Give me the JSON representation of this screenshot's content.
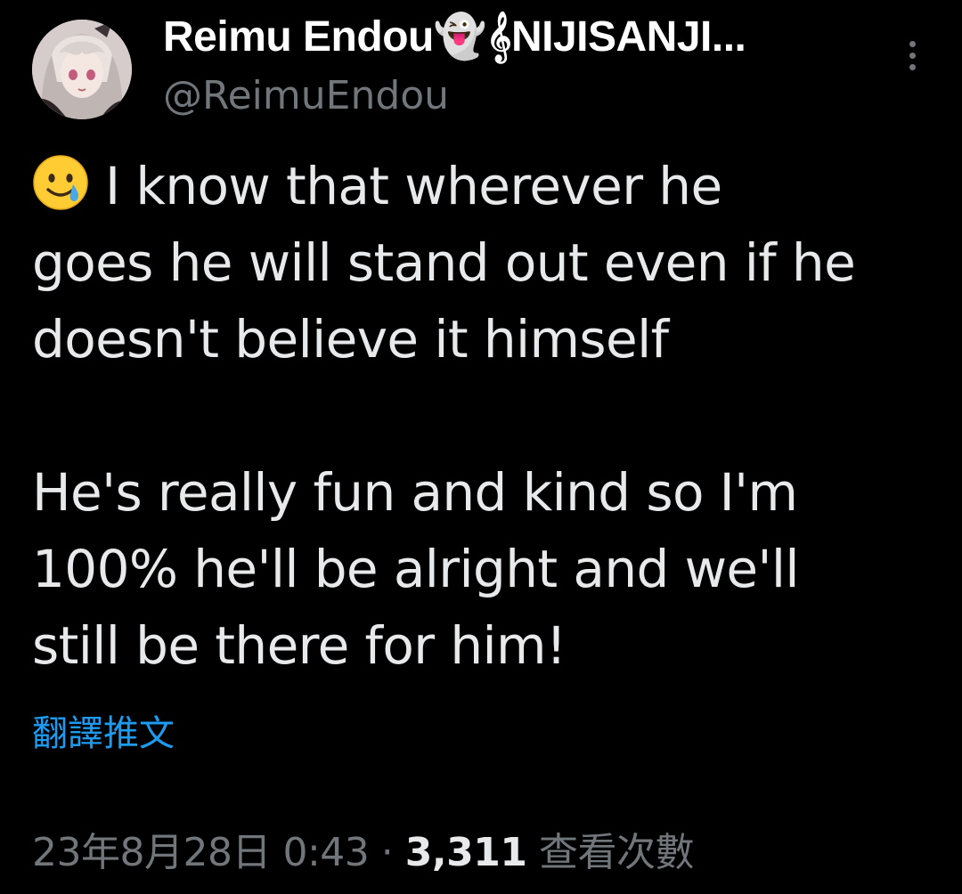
{
  "author": {
    "display_name": "Reimu Endou👻𝄞NIJISANJI...",
    "handle": "@ReimuEndou",
    "avatar_icon": "anime-avatar"
  },
  "tweet": {
    "emoji": "smiling-face-with-tear",
    "lines": [
      "I know that wherever he",
      "goes he will stand out even if he",
      "doesn't believe it himself",
      "",
      "He's really fun and kind so I'm",
      "100% he'll be alright and we'll",
      "still be there for him!"
    ],
    "translate_label": "翻譯推文"
  },
  "meta": {
    "timestamp": "23年8月28日 0:43",
    "separator": "·",
    "views_count": "3,311",
    "views_label": "查看次數"
  },
  "colors": {
    "background": "#000000",
    "text_primary": "#e7e9ea",
    "text_secondary": "#71767b",
    "link": "#1d9bf0"
  }
}
